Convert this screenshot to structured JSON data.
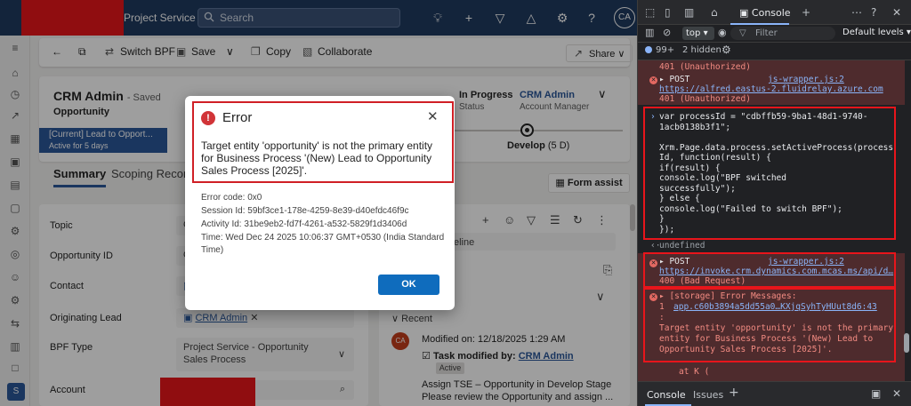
{
  "topbar": {
    "app_name": "Project Service",
    "search_placeholder": "Search",
    "avatar_initials": "CA"
  },
  "commandbar": {
    "switch_bpf": "Switch BPF",
    "save": "Save",
    "copy": "Copy",
    "collaborate": "Collaborate",
    "share": "Share"
  },
  "header": {
    "title": "CRM Admin",
    "saved": "- Saved",
    "entity": "Opportunity",
    "stage_current": "[Current] Lead to Opport...",
    "stage_duration": "Active for 5 days",
    "status_value": "In Progress",
    "status_label": "Status",
    "manager_value": "CRM Admin",
    "manager_label": "Account Manager",
    "develop_stage": "Develop",
    "develop_days": "(5 D)"
  },
  "tabs": [
    "Summary",
    "Scoping Records"
  ],
  "form_assist": "Form assist",
  "form": {
    "topic_label": "Topic",
    "topic_value": "C",
    "opportunity_id_label": "Opportunity ID",
    "opportunity_id_value": "O",
    "contact_label": "Contact",
    "originating_lead_label": "Originating Lead",
    "originating_lead_value": "CRM Admin",
    "bpf_type_label": "BPF Type",
    "bpf_type_value": "Project Service - Opportunity Sales Process",
    "account_label": "Account"
  },
  "timeline": {
    "label": "eline",
    "recent": "Recent",
    "avatar": "CA",
    "modified_on": "Modified on: 12/18/2025 1:29 AM",
    "task_modified_by": "Task modified by:",
    "task_modified_user": "CRM Admin",
    "active_badge": "Active",
    "desc_line1": "Assign TSE – Opportunity in Develop Stage",
    "desc_line2": "Please review the Opportunity and assign ..."
  },
  "dialog": {
    "title": "Error",
    "message": "Target entity 'opportunity' is not the primary entity for Business Process '(New) Lead to Opportunity Sales Process [2025]'.",
    "error_code": "Error code: 0x0",
    "session_id": "Session Id: 59bf3ce1-178e-4259-8e39-d40efdc46f9c",
    "activity_id": "Activity Id: 31be9eb2-fd7f-4261-a532-5829f1d3406d",
    "time_line1": "Time: Wed Dec 24 2025 10:06:37 GMT+0530 (India Standard",
    "time_line2": "Time)",
    "ok": "OK"
  },
  "devtools": {
    "console_tab": "Console",
    "context": "top",
    "filter_placeholder": "Filter",
    "levels": "Default levels",
    "issue_count": "99+",
    "hidden": "2 hidden",
    "log1_status": "401 (Unauthorized)",
    "log2_method": "POST",
    "log2_source": "js-wrapper.js:2",
    "log2_url": "https://alfred.eastus-2.fluidrelay.azure.com",
    "log2_status": "401 (Unauthorized)",
    "code_lines": [
      "var processId = \"cdbffb59-9ba1-48d1-9740-",
      "1acb0138b3f1\";",
      "",
      "Xrm.Page.data.process.setActiveProcess(process",
      "Id, function(result) {",
      "    if(result) {",
      "        console.log(\"BPF switched",
      "successfully\");",
      "    } else {",
      "        console.log(\"Failed to switch BPF\");",
      "    }",
      "});"
    ],
    "undefined": "undefined",
    "log3_method": "POST",
    "log3_source": "js-wrapper.js:2",
    "log3_url": "https://invoke.crm.dynamics.com.mcas.ms/api/d…",
    "log3_status": "400 (Bad Request)",
    "log4_head": "[storage] Error Messages:",
    "log4_index": "1",
    "log4_src": "app.c60b3894a5dd55a0…KXjqSyhTyHUut8d6:43",
    "log4_colon": ":",
    "log4_msg": [
      "Target entity 'opportunity' is not the primary",
      "entity for Business Process '(New) Lead to",
      "Opportunity Sales Process [2025]'."
    ],
    "log4_at": "at K (",
    "bottom_console": "Console",
    "bottom_issues": "Issues"
  }
}
